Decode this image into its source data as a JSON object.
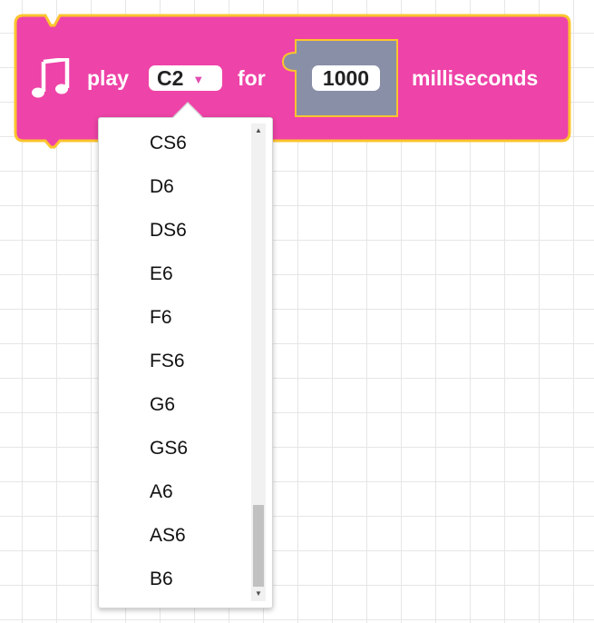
{
  "block": {
    "play_label": "play",
    "note_value": "C2",
    "dropdown_arrow": "▼",
    "for_label": "for",
    "duration_value": "1000",
    "unit_label": "milliseconds",
    "icon": "music-note-icon",
    "colors": {
      "fill": "#ee43a8",
      "outline": "#fbc42e",
      "input_socket": "#8a8fa8"
    }
  },
  "dropdown": {
    "items": [
      "CS6",
      "D6",
      "DS6",
      "E6",
      "F6",
      "FS6",
      "G6",
      "GS6",
      "A6",
      "AS6",
      "B6"
    ],
    "scroll_up_icon": "▲",
    "scroll_down_icon": "▼"
  }
}
